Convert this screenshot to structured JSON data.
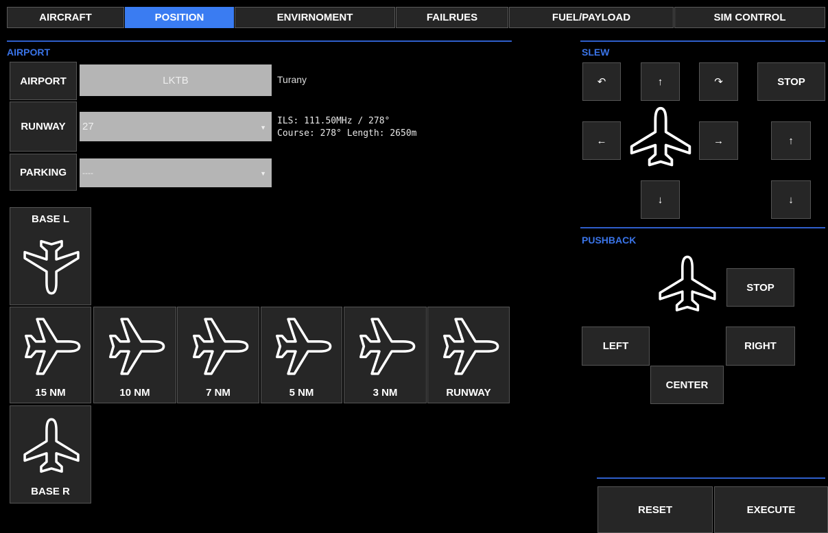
{
  "tabs": [
    {
      "label": "AIRCRAFT"
    },
    {
      "label": "POSITION",
      "active": true
    },
    {
      "label": "ENVIRNOMENT"
    },
    {
      "label": "FAILRUES"
    },
    {
      "label": "FUEL/PAYLOAD"
    },
    {
      "label": "SIM CONTROL"
    }
  ],
  "airport_section": {
    "title": "AIRPORT",
    "airport_label": "AIRPORT",
    "airport_value": "LKTB",
    "airport_name": "Turany",
    "runway_label": "RUNWAY",
    "runway_value": "27",
    "runway_info_1": "ILS: 111.50MHz / 278°",
    "runway_info_2": "Course: 278° Length: 2650m",
    "parking_label": "PARKING",
    "parking_value": "----"
  },
  "positions": {
    "base_l": "BASE L",
    "nm15": "15 NM",
    "nm10": "10 NM",
    "nm7": "7 NM",
    "nm5": "5 NM",
    "nm3": "3 NM",
    "runway": "RUNWAY",
    "base_r": "BASE R"
  },
  "slew": {
    "title": "SLEW",
    "rotate_left": "↶",
    "forward": "↑",
    "rotate_right": "↷",
    "stop": "STOP",
    "left": "←",
    "right": "→",
    "up": "↑",
    "backward": "↓",
    "down": "↓"
  },
  "pushback": {
    "title": "PUSHBACK",
    "stop": "STOP",
    "left": "LEFT",
    "right": "RIGHT",
    "center": "CENTER"
  },
  "footer": {
    "reset": "RESET",
    "execute": "EXECUTE"
  },
  "colors": {
    "accent": "#3a7cf2",
    "section_label": "#3a74e8",
    "button_bg": "#262626",
    "field_bg": "#b5b5b5"
  },
  "icons": {
    "plane": "airplane-outline-icon",
    "caret": "dropdown-caret-icon"
  }
}
